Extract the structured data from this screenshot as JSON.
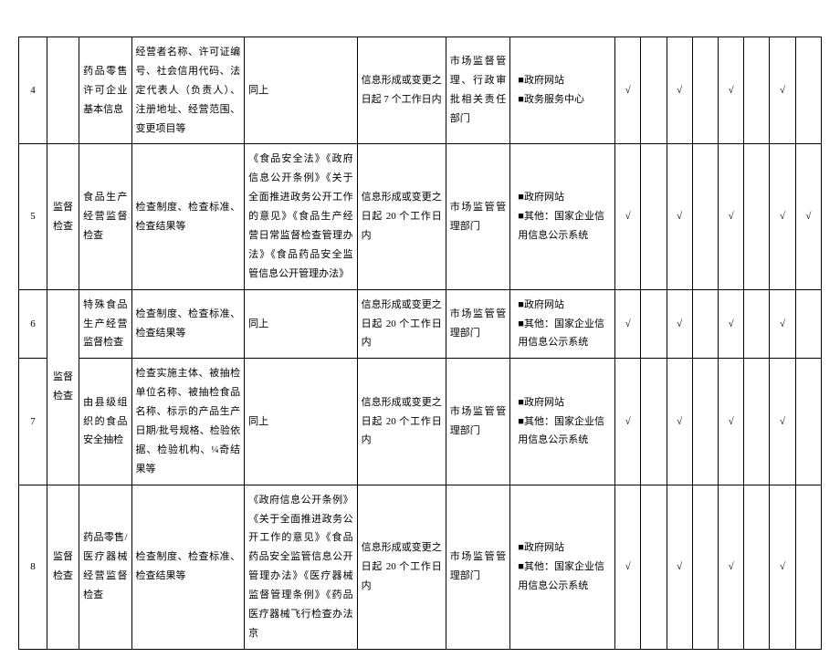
{
  "check": "√",
  "rows": [
    {
      "idx": "4",
      "cat": "",
      "item": "药品零售许可企业基本信息",
      "content": "经营者名称、许可证编号、社会信用代码、法定代表人（负责人）、注册地址、经营范围、变更项目等",
      "basis": "同上",
      "time": "信息形成或变更之日起 7 个工作日内",
      "subj": "市场监督管理、行政审批相关责任部门",
      "channel": "■政府网站\n■政务服务中心",
      "chk": [
        true,
        false,
        true,
        false,
        true,
        false,
        true,
        false
      ]
    },
    {
      "idx": "5",
      "cat": "监督检查",
      "item": "食品生产经营监督检查",
      "content": "检查制度、检查标准、检查结果等",
      "basis": "《食品安全法》《政府信息公开条例》《关于全面推进政务公开工作的意见》《食品生产经营日常监督检查管理办法》《食品药品安全监管信息公开管理办法》",
      "time": "信息形成或变更之日起 20 个工作日内",
      "subj": "市场监管管理部门",
      "channel": "■政府网站\n■其他：国家企业信用信息公示系统",
      "chk": [
        true,
        false,
        true,
        false,
        true,
        false,
        true,
        true
      ]
    },
    {
      "idx": "6",
      "cat": "监督检查",
      "item": "特殊食品生产经营监督检查",
      "content": "检查制度、检查标准、检查结果等",
      "basis": "同上",
      "time": "信息形成或变更之日起 20 个工作日内",
      "subj": "市场监管管理部门",
      "channel": "■政府网站\n■其他：国家企业信用信息公示系统",
      "chk": [
        true,
        false,
        true,
        false,
        true,
        false,
        true,
        false
      ]
    },
    {
      "idx": "7",
      "cat": "监督检查",
      "item": "由县级组织的食品安全抽检",
      "content": "检查实施主体、被抽检单位名称、被抽检食品名称、标示的产品生产日期/批号规格、检验依据、检验机构、¼奇结果等",
      "basis": "同上",
      "time": "信息形成或变更之日起 20 个工作日内",
      "subj": "市场监管管理部门",
      "channel": "■政府网站\n■其他：国家企业信用信息公示系统",
      "chk": [
        true,
        false,
        true,
        false,
        true,
        false,
        true,
        false
      ]
    },
    {
      "idx": "8",
      "cat": "监督检查",
      "item": "药品零售/医疗器械经营监督检查",
      "content": "检查制度、检查标准、检查结果等",
      "basis": "《政府信息公开条例》《关于全面推进政务公开工作的意见》《食品药品安全监管信息公开管理办法》《医疗器械监督管理条例》《药品医疗器械飞行检查办法京",
      "time": "信息形成或变更之日起 20 个工作日内",
      "subj": "市场监管管理部门",
      "channel": "■政府网站\n■其他：国家企业信用信息公示系统",
      "chk": [
        true,
        false,
        true,
        false,
        true,
        false,
        true,
        false
      ]
    }
  ]
}
